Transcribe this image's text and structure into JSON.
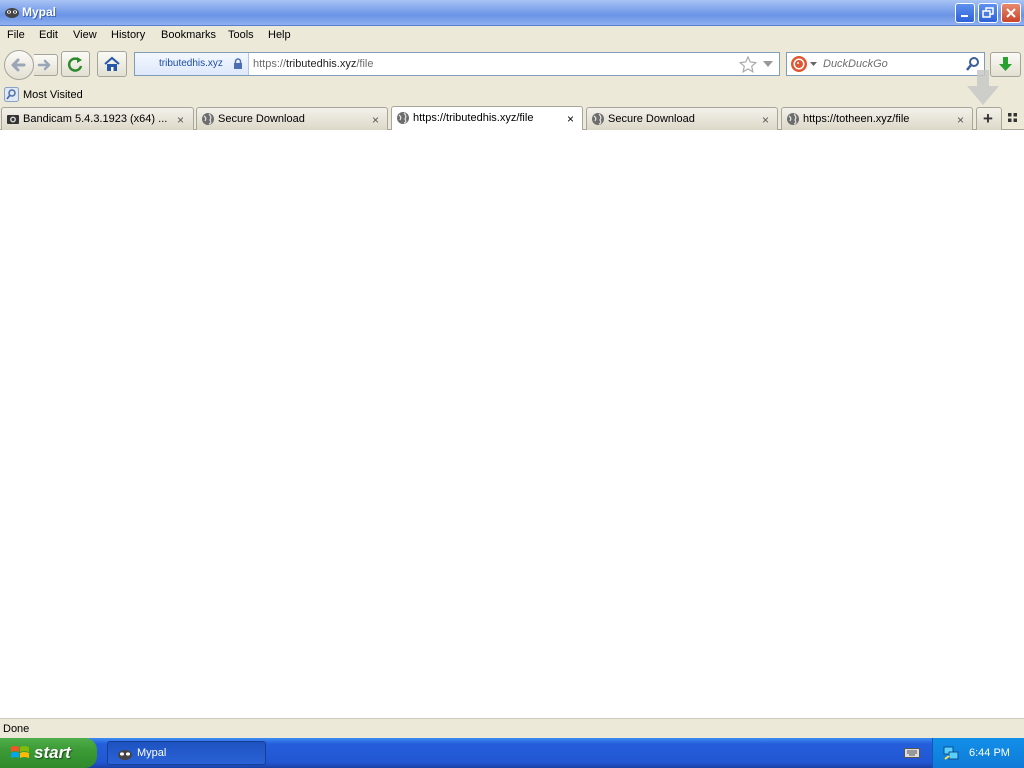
{
  "window": {
    "title": "Mypal"
  },
  "menu": [
    {
      "label": "File"
    },
    {
      "label": "Edit"
    },
    {
      "label": "View"
    },
    {
      "label": "History"
    },
    {
      "label": "Bookmarks"
    },
    {
      "label": "Tools"
    },
    {
      "label": "Help"
    }
  ],
  "urlbar": {
    "identity_host": "tributedhis.xyz",
    "scheme": "https://",
    "host": "tributedhis.xyz",
    "path": "/file"
  },
  "search": {
    "engine": "duckduckgo-icon",
    "placeholder": "DuckDuckGo"
  },
  "bookmarks": {
    "most_visited": "Most Visited"
  },
  "tabs": [
    {
      "label": "Bandicam 5.4.3.1923 (x64) ...",
      "icon": "bandicam-icon",
      "selected": false
    },
    {
      "label": "Secure Download",
      "icon": "globe-icon",
      "selected": false
    },
    {
      "label": "https://tributedhis.xyz/file",
      "icon": "globe-icon",
      "selected": true
    },
    {
      "label": "Secure Download",
      "icon": "globe-icon",
      "selected": false
    },
    {
      "label": "https://totheen.xyz/file",
      "icon": "globe-icon",
      "selected": false
    }
  ],
  "tab_close_glyph": "×",
  "status": {
    "text": "Done"
  },
  "taskbar": {
    "start_label": "start",
    "task_label": "Mypal",
    "clock": "6:44 PM"
  },
  "colors": {
    "titlebar": "#7ea3ea",
    "taskbar": "#245edb",
    "start": "#3c9b37",
    "download_green": "#27a130"
  }
}
